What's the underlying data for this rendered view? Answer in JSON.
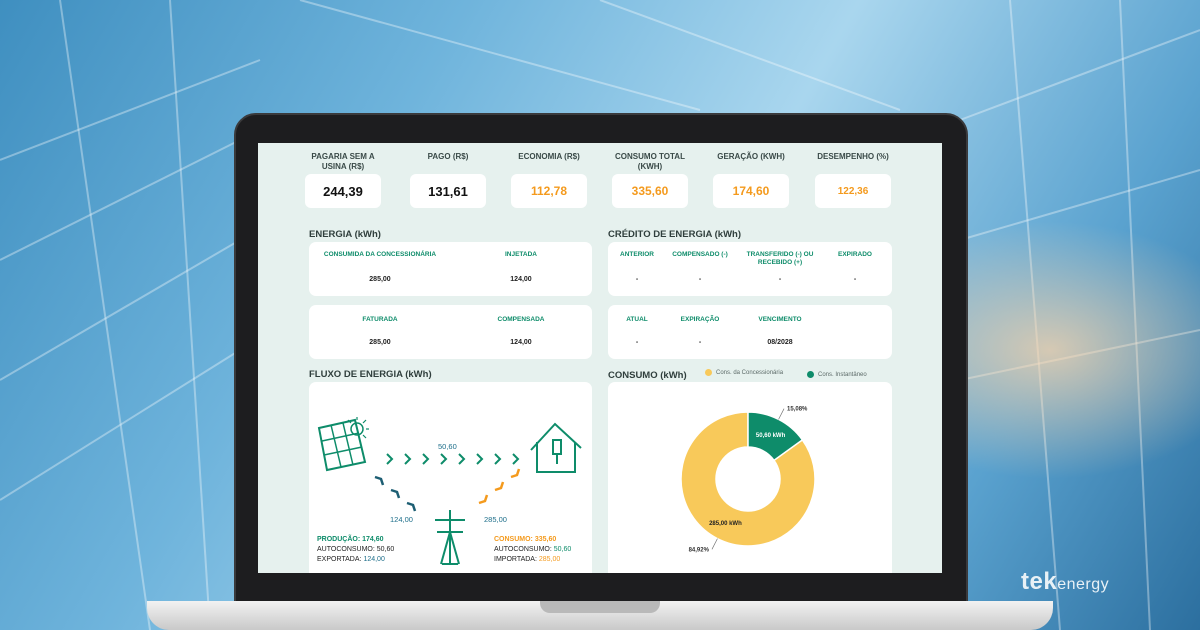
{
  "stats": [
    {
      "label": "PAGARIA SEM A USINA (R$)",
      "value": "244,39"
    },
    {
      "label": "PAGO (R$)",
      "value": "131,61"
    },
    {
      "label": "ECONOMIA (R$)",
      "value": "112,78"
    },
    {
      "label": "CONSUMO TOTAL (KWH)",
      "value": "335,60"
    },
    {
      "label": "GERAÇÃO (KWH)",
      "value": "174,60"
    },
    {
      "label": "DESEMPENHO (%)",
      "value": "122,36"
    }
  ],
  "energia": {
    "title": "ENERGIA (kWh)",
    "row1": {
      "h1": "CONSUMIDA DA CONCESSIONÁRIA",
      "v1": "285,00",
      "h2": "INJETADA",
      "v2": "124,00"
    },
    "row2": {
      "h1": "FATURADA",
      "v1": "285,00",
      "h2": "COMPENSADA",
      "v2": "124,00"
    }
  },
  "credito": {
    "title": "CRÉDITO DE ENERGIA (kWh)",
    "row1": {
      "h1": "ANTERIOR",
      "v1": "-",
      "h2": "COMPENSADO (-)",
      "v2": "-",
      "h3": "TRANSFERIDO (-) OU RECEBIDO (+)",
      "v3": "-",
      "h4": "EXPIRADO",
      "v4": "-"
    },
    "row2": {
      "h1": "ATUAL",
      "v1": "-",
      "h2": "EXPIRAÇÃO",
      "v2": "-",
      "h3": "VENCIMENTO",
      "v3": "08/2028"
    }
  },
  "fluxo": {
    "title": "FLUXO DE ENERGIA (kWh)",
    "solar_to_house": "50,60",
    "grid_in": "124,00",
    "grid_out": "285,00",
    "producao_label": "PRODUÇÃO: 174,60",
    "autoconsumo_prod_label": "AUTOCONSUMO: 50,60",
    "exportada_label": "EXPORTADA:",
    "exportada_value": "124,00",
    "consumo_label": "CONSUMO: 335,60",
    "autoconsumo_cons_label": "AUTOCONSUMO:",
    "autoconsumo_cons_value": "50,60",
    "importada_label": "IMPORTADA:",
    "importada_value": "285,00"
  },
  "consumo": {
    "title": "CONSUMO (kWh)",
    "legend1": "Cons. da Concessionária",
    "legend2": "Cons. Instantâneo",
    "color1": "#f8c95a",
    "color2": "#0e8c6a"
  },
  "chart_data": {
    "type": "pie",
    "categories": [
      "Cons. da Concessionária",
      "Cons. Instantâneo"
    ],
    "values": [
      285.0,
      50.6
    ],
    "value_labels": [
      "285,00 kWh",
      "50,60 kWh"
    ],
    "percent_labels": [
      "84,92%",
      "15,08%"
    ]
  },
  "brand": {
    "tek": "tek",
    "energy": "energy"
  }
}
